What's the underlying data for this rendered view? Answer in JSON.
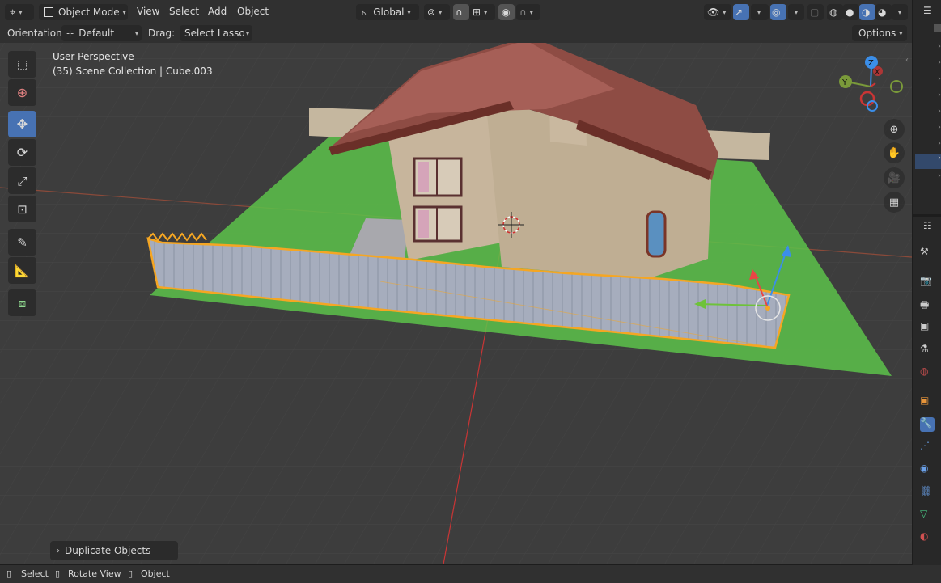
{
  "header": {
    "mode": "Object Mode",
    "menus": [
      "View",
      "Select",
      "Add",
      "Object"
    ],
    "transform_orientation": "Global"
  },
  "tool_header": {
    "orientation_label": "Orientation:",
    "orientation_value": "Default",
    "drag_label": "Drag:",
    "drag_value": "Select Lasso",
    "options": "Options"
  },
  "viewport": {
    "view_name": "User Perspective",
    "collection_info": "(35) Scene Collection | Cube.003",
    "gizmo": {
      "z": "Z",
      "y": "Y",
      "x": "X"
    },
    "operator_panel": "Duplicate Objects"
  },
  "status": {
    "items": [
      "Select",
      "Rotate View",
      "Object"
    ]
  },
  "colors": {
    "accent": "#4772b3",
    "selection": "#f5a623",
    "ground": "#5cc24a",
    "roof": "#8e4c44",
    "walls": "#c7b59c",
    "axis_red": "#c93535",
    "axis_green": "#7a9a3a"
  },
  "icons": {
    "tools": [
      "select-box-icon",
      "cursor-icon",
      "move-icon",
      "rotate-icon",
      "scale-icon",
      "transform-icon",
      "annotate-icon",
      "measure-icon",
      "add-cube-icon"
    ],
    "nav": [
      "zoom-icon",
      "pan-hand-icon",
      "camera-icon",
      "grid-ortho-icon"
    ]
  }
}
